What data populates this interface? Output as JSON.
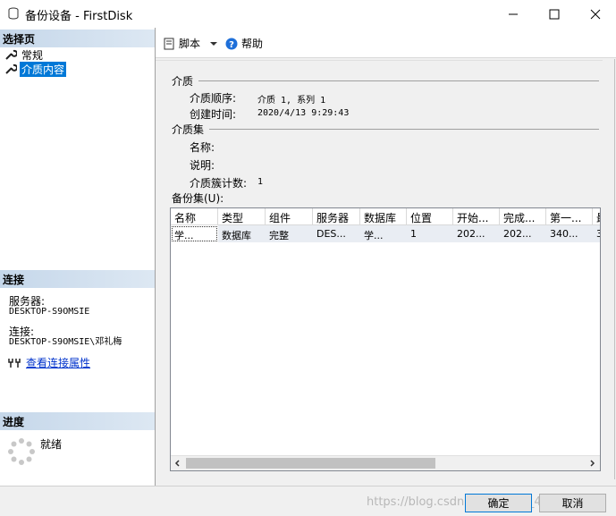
{
  "window": {
    "title": "备份设备 - FirstDisk"
  },
  "left": {
    "select_page_header": "选择页",
    "nav_items": [
      {
        "label": "常规",
        "selected": false
      },
      {
        "label": "介质内容",
        "selected": true
      }
    ],
    "connection_header": "连接",
    "server_label": "服务器:",
    "server_value": "DESKTOP-S9OMSIE",
    "connection_label": "连接:",
    "connection_value": "DESKTOP-S9OMSIE\\邓礼梅",
    "view_link": "查看连接属性",
    "progress_header": "进度",
    "status": "就绪"
  },
  "toolbar": {
    "script_label": "脚本",
    "help_label": "帮助"
  },
  "media": {
    "group_title": "介质",
    "sequence_label": "介质顺序:",
    "sequence_value": "介质 1, 系列 1",
    "created_label": "创建时间:",
    "created_value": "2020/4/13 9:29:43"
  },
  "media_set": {
    "group_title": "介质集",
    "name_label": "名称:",
    "desc_label": "说明:",
    "family_count_label": "介质簇计数:",
    "family_count_value": "1"
  },
  "backup_sets": {
    "label": "备份集(U):",
    "columns": [
      "名称",
      "类型",
      "组件",
      "服务器",
      "数据库",
      "位置",
      "开始...",
      "完成...",
      "第一...",
      "最"
    ],
    "rows": [
      [
        "学...",
        "数据库",
        "完整",
        "DES...",
        "学...",
        "1",
        "202...",
        "202...",
        "340...",
        "3"
      ]
    ]
  },
  "buttons": {
    "ok": "确定",
    "cancel": "取消"
  },
  "watermark": "https://blog.csdn.net/weixin_43611513"
}
